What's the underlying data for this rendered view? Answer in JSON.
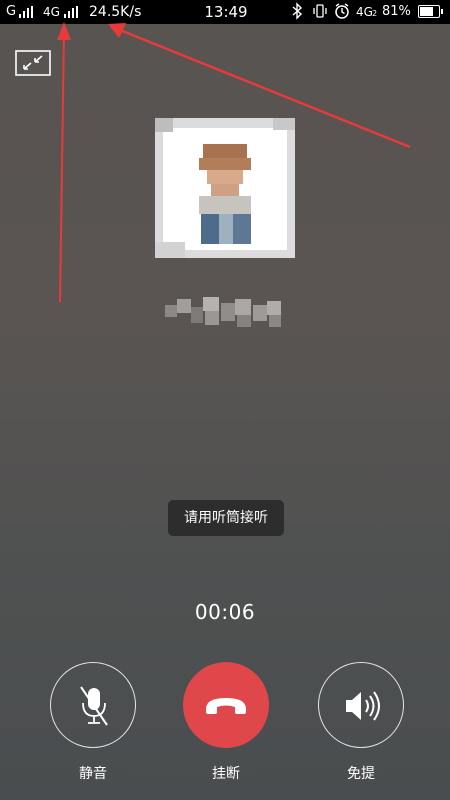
{
  "status_bar": {
    "sim1": "G",
    "network_type": "4G",
    "speed": "24.5K/s",
    "time": "13:49",
    "network_type_2": "4G",
    "sim_slot_sub": "2",
    "battery": "81%",
    "battery_level": 0.81,
    "icons": [
      "signal-icon",
      "signal-icon",
      "bluetooth-icon",
      "vibrate-icon",
      "alarm-icon",
      "battery-icon"
    ]
  },
  "call": {
    "toast": "请用听筒接听",
    "duration": "00:06"
  },
  "controls": {
    "mute_label": "静音",
    "hangup_label": "挂断",
    "speaker_label": "免提"
  },
  "colors": {
    "hangup": "#e0474b",
    "annotation_arrow": "#e83a3a"
  }
}
